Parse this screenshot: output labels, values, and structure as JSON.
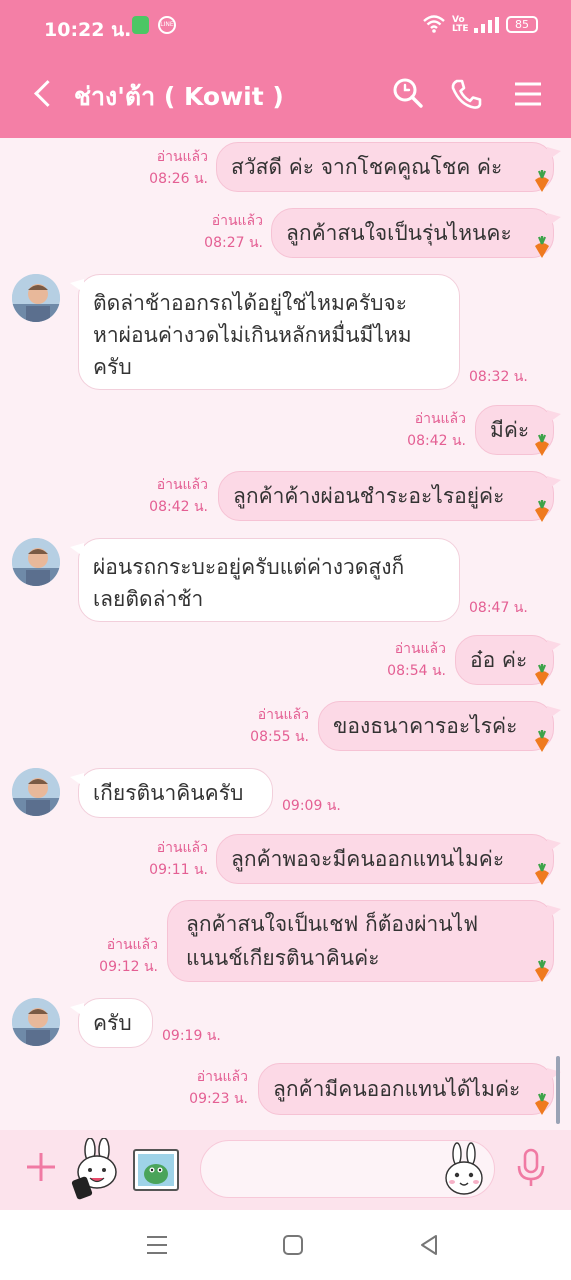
{
  "status_bar": {
    "time": "10:22 น.",
    "battery": "85",
    "volte": "Vo\nLTE",
    "app2_label": "LINE"
  },
  "header": {
    "title": "ช่าง'ต้า ( Kowit )"
  },
  "colors": {
    "accent": "#f47fa6",
    "outgoing_bubble": "#fcd9e6",
    "incoming_bubble": "#ffffff",
    "meta_text": "#e45f93",
    "background": "#fdf0f5"
  },
  "messages": [
    {
      "dir": "out",
      "text": "สวัสดี ค่ะ จากโชคคูณโชค  ค่ะ",
      "read": "อ่านแล้ว",
      "time": "08:26 น."
    },
    {
      "dir": "out",
      "text": "ลูกค้าสนใจเป็นรุ่นไหนคะ",
      "read": "อ่านแล้ว",
      "time": "08:27 น."
    },
    {
      "dir": "in",
      "lines": [
        "ติดล่าช้าออกรถได้อยู่ใช่ไหมครับจะ",
        "หาผ่อนค่างวดไม่เกินหลักหมื่นมีไหม",
        "ครับ"
      ],
      "time": "08:32 น."
    },
    {
      "dir": "out",
      "text": "มีค่ะ",
      "read": "อ่านแล้ว",
      "time": "08:42 น."
    },
    {
      "dir": "out",
      "text": "ลูกค้าค้างผ่อนชำระอะไรอยู่ค่ะ",
      "read": "อ่านแล้ว",
      "time": "08:42 น."
    },
    {
      "dir": "in",
      "lines": [
        "ผ่อนรถกระบะอยู่ครับแต่ค่างวดสูงก็",
        "เลยติดล่าช้า"
      ],
      "time": "08:47 น."
    },
    {
      "dir": "out",
      "text": "อ๋อ ค่ะ",
      "read": "อ่านแล้ว",
      "time": "08:54 น."
    },
    {
      "dir": "out",
      "text": "ของธนาคารอะไรค่ะ",
      "read": "อ่านแล้ว",
      "time": "08:55 น."
    },
    {
      "dir": "in",
      "text": "เกียรตินาคินครับ",
      "time": "09:09 น."
    },
    {
      "dir": "out",
      "text": "ลูกค้าพอจะมีคนออกแทนไมค่ะ",
      "read": "อ่านแล้ว",
      "time": "09:11 น."
    },
    {
      "dir": "out",
      "lines": [
        "ลูกค้าสนใจเป็นเชฟ ก็ต้องผ่านไฟ",
        "แนนช์เกียรตินาคินค่ะ"
      ],
      "read": "อ่านแล้ว",
      "time": "09:12 น."
    },
    {
      "dir": "in",
      "text": "ครับ",
      "time": "09:19 น."
    },
    {
      "dir": "out",
      "text": "ลูกค้ามีคนออกแทนได้ไมค่ะ",
      "read": "อ่านแล้ว",
      "time": "09:23 น."
    }
  ],
  "input": {
    "placeholder": ""
  },
  "icons": {
    "plus": "plus-icon",
    "sticker": "sticker-icon",
    "gallery": "gallery-icon",
    "emoji": "emoji-icon",
    "mic": "microphone-icon",
    "search": "search-icon",
    "call": "phone-icon",
    "menu": "menu-icon",
    "back": "back-icon"
  }
}
